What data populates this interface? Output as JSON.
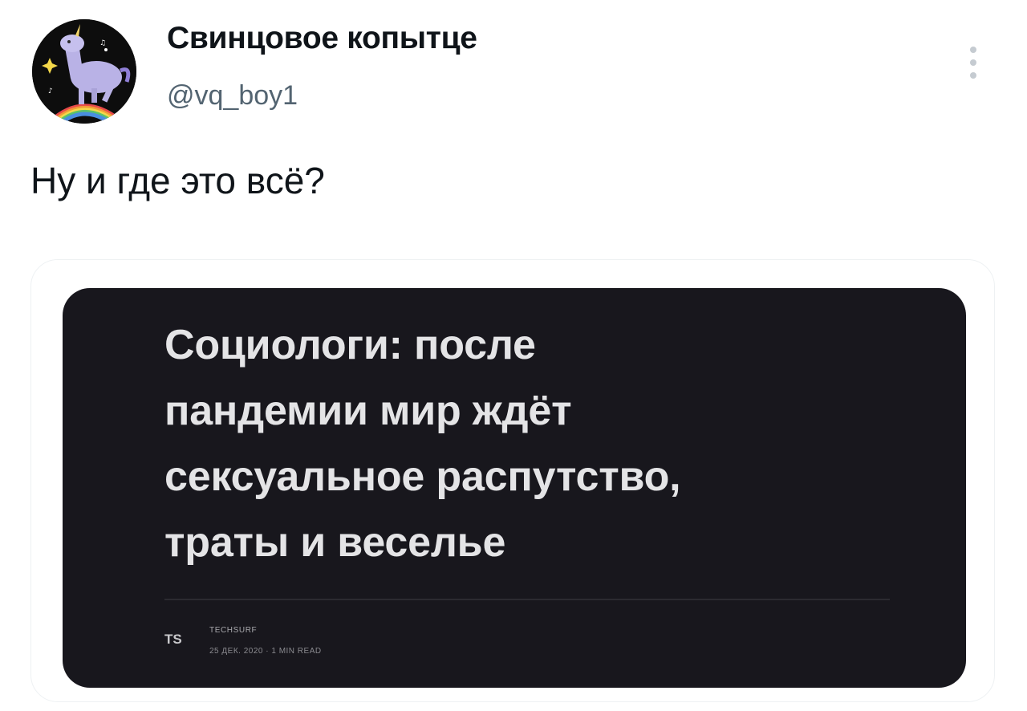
{
  "author": {
    "display_name": "Свинцовое копытце",
    "handle": "@vq_boy1",
    "avatar_icon": "unicorn-avatar-icon"
  },
  "tweet": {
    "text": "Ну и где это всё?"
  },
  "media": {
    "headline_lines": [
      "Социологи: после",
      "пандемии мир ждёт",
      "сексуальное распутство,",
      "траты и веселье"
    ],
    "source_logo": "TS",
    "source_name": "TECHSURF",
    "source_meta": "25 ДЕК. 2020  ·  1 MIN READ"
  },
  "colors": {
    "text_primary": "#0f1419",
    "text_secondary": "#536471",
    "image_background": "#18171d",
    "headline": "#e4e4e6"
  }
}
